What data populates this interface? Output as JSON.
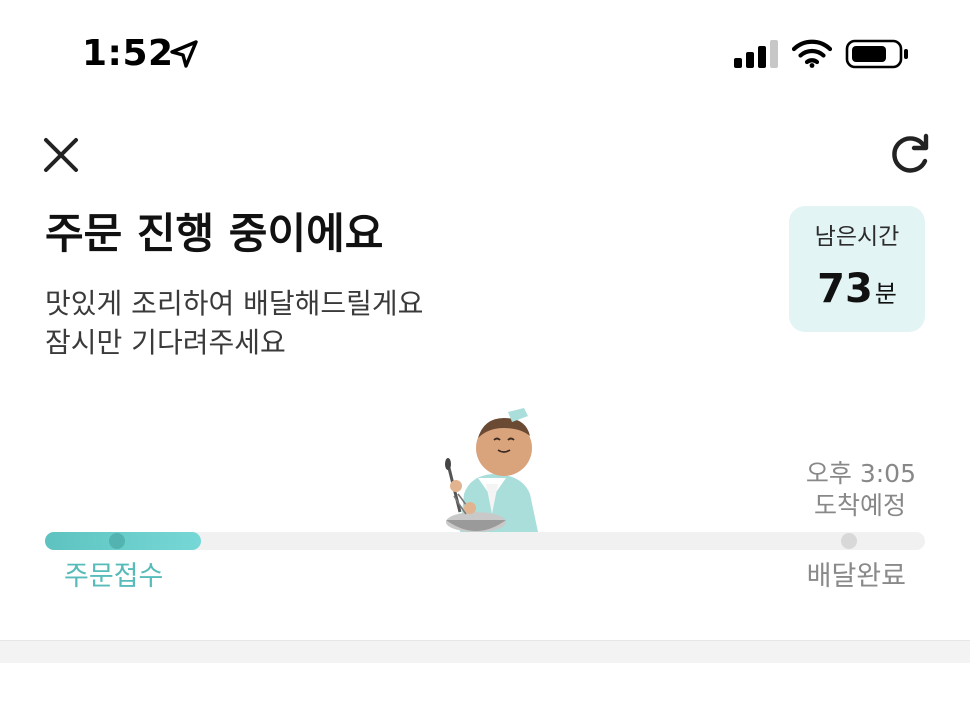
{
  "status_bar": {
    "time": "1:52",
    "icons": [
      "location-arrow-icon",
      "cellular-signal-icon",
      "wifi-icon",
      "battery-icon"
    ]
  },
  "header": {
    "close_icon": "close-icon",
    "refresh_icon": "refresh-icon"
  },
  "order_status": {
    "title": "주문 진행 중이에요",
    "subtitle_line1": "맛있게 조리하여 배달해드릴게요",
    "subtitle_line2": "잠시만 기다려주세요"
  },
  "remaining_time": {
    "label": "남은시간",
    "value": "73",
    "unit": "분"
  },
  "eta": {
    "time": "오후 3:05",
    "label": "도착예정"
  },
  "progress": {
    "fraction": 0.177,
    "start_label": "주문접수",
    "end_label": "배달완료"
  },
  "colors": {
    "accent": "#5EC3C0",
    "time_card_bg": "#E3F4F4",
    "track": "#F1F1F1",
    "muted_text": "#888888"
  }
}
